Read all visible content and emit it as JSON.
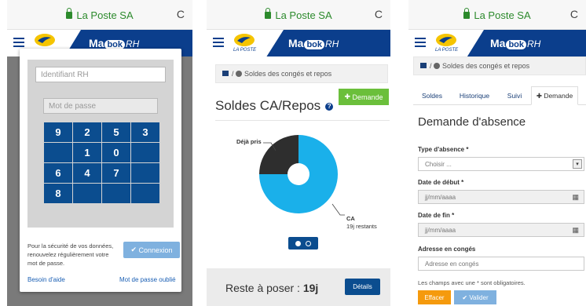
{
  "browser": {
    "url": "La Poste SA",
    "reload_glyph": "C"
  },
  "header": {
    "brand_main": "Ma",
    "brand_bubble": "bok",
    "brand_suffix": "RH",
    "logo_caption": "LA POSTE"
  },
  "login": {
    "id_placeholder": "Identifiant RH",
    "pw_placeholder": "Mot de passe",
    "keys": [
      "9",
      "2",
      "5",
      "3",
      "",
      "1",
      "0",
      "",
      "6",
      "4",
      "7",
      "",
      "8",
      "",
      "",
      ""
    ],
    "security_note": "Pour la sécurité de vos données, renouvelez régulièrement votre mot de passe.",
    "connect_button": "Connexion",
    "help_link": "Besoin d'aide",
    "forgot_link": "Mot de passe oublié"
  },
  "soldes": {
    "breadcrumb": "Soldes des congés et repos",
    "title": "Soldes CA/Repos",
    "help_glyph": "?",
    "add_button": "Demande",
    "pie_label_taken": "Déjà pris",
    "pie_label_ca": "CA",
    "pie_label_ca_sub": "19j restants",
    "reste_label": "Reste à poser : ",
    "reste_value": "19j",
    "details_button": "Détails",
    "colors": {
      "taken": "#2e2e2e",
      "remaining": "#1ab0ea"
    }
  },
  "chart_data": {
    "type": "pie",
    "categories": [
      "Déjà pris",
      "CA"
    ],
    "values": [
      25,
      75
    ]
  },
  "demande": {
    "breadcrumb": "Soldes des congés et repos",
    "tabs": [
      {
        "label": "Soldes"
      },
      {
        "label": "Historique"
      },
      {
        "label": "Suivi"
      },
      {
        "label": "Demande"
      }
    ],
    "title": "Demande d'absence",
    "type_label": "Type d'absence *",
    "type_value": "Choisir ...",
    "start_label": "Date de début *",
    "start_placeholder": "jj/mm/aaaa",
    "end_label": "Date de fin *",
    "end_placeholder": "jj/mm/aaaa",
    "address_label": "Adresse en congés",
    "address_placeholder": "Adresse en congés",
    "required_note": "Les champs avec une * sont obligatoires.",
    "clear_button": "Effacer",
    "submit_button": "Valider"
  }
}
